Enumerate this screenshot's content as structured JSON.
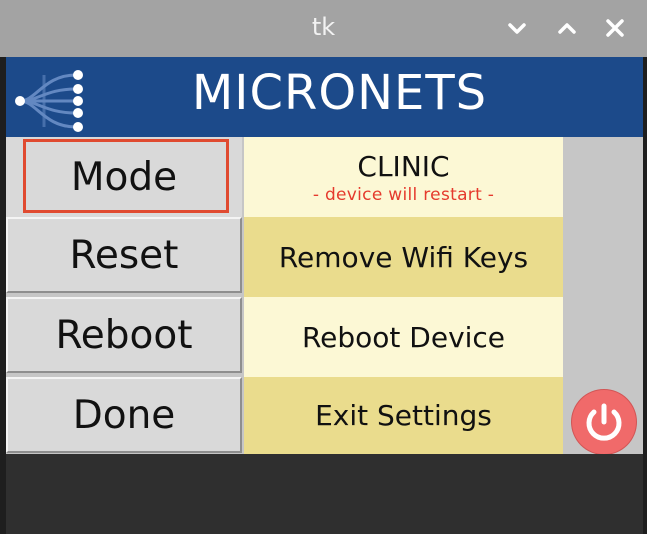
{
  "window": {
    "title": "tk"
  },
  "header": {
    "brand": "MICRONETS"
  },
  "rows": [
    {
      "button": "Mode",
      "description": "CLINIC",
      "note": "- device will restart -"
    },
    {
      "button": "Reset",
      "description": "Remove Wifi Keys"
    },
    {
      "button": "Reboot",
      "description": "Reboot Device"
    },
    {
      "button": "Done",
      "description": "Exit Settings"
    }
  ],
  "icons": {
    "minimize": "chevron-down-icon",
    "maximize": "chevron-up-icon",
    "close": "close-icon",
    "logo": "micronets-logo",
    "power": "power-icon"
  },
  "colors": {
    "header": "#1c4a8a",
    "focus": "#e04a30",
    "note": "#e53a2d",
    "power": "#f06a6a",
    "row_light": "#fcf8d5",
    "row_dark": "#eadc8d"
  }
}
